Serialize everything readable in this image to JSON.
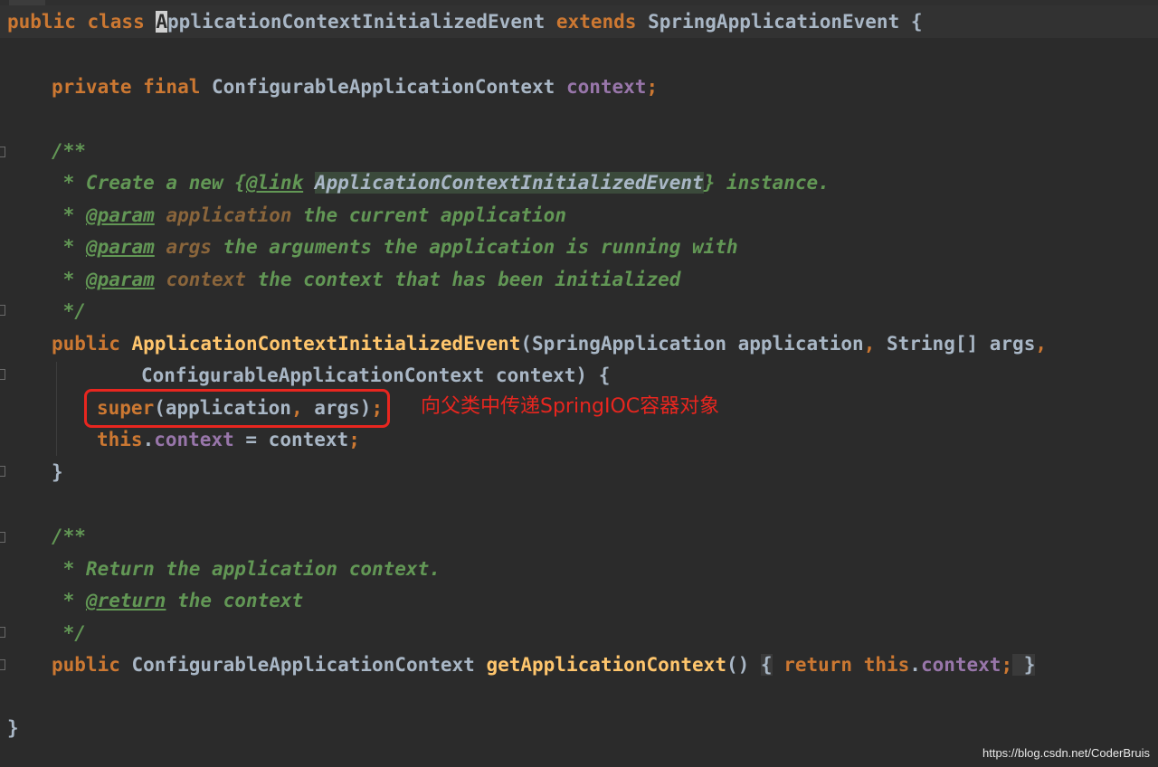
{
  "code": {
    "l1": {
      "kw1": "public class ",
      "caret": "A",
      "cls": "pplicationContextInitializedEvent",
      "kw2": " extends ",
      "parent": "SpringApplicationEvent",
      "brace": " {"
    },
    "l2": {
      "kw": "private final ",
      "type": "ConfigurableApplicationContext ",
      "field": "context",
      "semi": ";"
    },
    "l3": {
      "text": "/**"
    },
    "l4": {
      "pre": " * Create a new {",
      "tag": "@link",
      "sp": " ",
      "cls": "ApplicationContextInitializedEvent",
      "post": "} instance."
    },
    "l5": {
      "pre": " * ",
      "tag": "@param",
      "sp": " ",
      "name": "application",
      "post": " the current application"
    },
    "l6": {
      "pre": " * ",
      "tag": "@param",
      "sp": " ",
      "name": "args",
      "post": " the arguments the application is running with"
    },
    "l7": {
      "pre": " * ",
      "tag": "@param",
      "sp": " ",
      "name": "context",
      "post": " the context that has been initialized"
    },
    "l8": {
      "text": " */"
    },
    "l9": {
      "kw": "public ",
      "method": "ApplicationContextInitializedEvent",
      "p1": "(SpringApplication application",
      "c1": ",",
      "p2": " String[] args",
      "c2": ","
    },
    "l10": {
      "text": "ConfigurableApplicationContext context) {"
    },
    "l11": {
      "kw": "super",
      "a": "(application",
      "c": ",",
      "b": " args)",
      "semi": ";"
    },
    "l12": {
      "kw": "this",
      "dot": ".",
      "field": "context",
      "eq": " = context",
      "semi": ";"
    },
    "l13": {
      "text": "}"
    },
    "l14": {
      "text": "/**"
    },
    "l15": {
      "text": " * Return the application context."
    },
    "l16": {
      "pre": " * ",
      "tag": "@return",
      "post": " the context"
    },
    "l17": {
      "text": " */"
    },
    "l18": {
      "kw": "public ",
      "type": "ConfigurableApplicationContext ",
      "method": "getApplicationContext",
      "paren": "()",
      "ob": "{",
      "kw2": " return this",
      "dot": ".",
      "field": "context",
      "semi": ";",
      "cb": " }"
    },
    "l19": {
      "text": "}"
    }
  },
  "annotation": {
    "text": "向父类中传递SpringIOC容器对象",
    "color": "#e8261f"
  },
  "watermark": "https://blog.csdn.net/CoderBruis",
  "theme": {
    "background": "#2b2b2b",
    "keyword": "#cc7832",
    "method": "#ffc66d",
    "field": "#9876aa",
    "comment": "#629755",
    "text": "#a9b7c6"
  }
}
